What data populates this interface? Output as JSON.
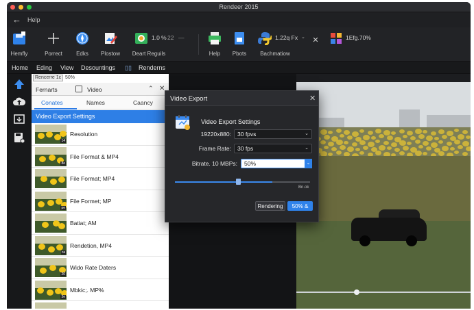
{
  "window": {
    "title": "Rendeer 2015"
  },
  "nav": {
    "back_label": "←",
    "help_label": "Help"
  },
  "ribbon": {
    "tools": [
      {
        "label": "Hemfly"
      },
      {
        "label": "Porrect"
      },
      {
        "label": "Edks"
      },
      {
        "label": "Plostow"
      },
      {
        "label": "Deart Reguils",
        "value": "1.0 %",
        "value2": "22"
      },
      {
        "label": "Help"
      },
      {
        "label": "Pbots"
      },
      {
        "label": "Bachmatiow",
        "value": "1.22q Fx"
      },
      {
        "label": "",
        "value": "1Efg.70%"
      }
    ],
    "close_glyph": "✕"
  },
  "menu": {
    "items": [
      "Home",
      "Eding",
      "View",
      "Desountings",
      "Renderns"
    ],
    "icon_glyph": "▯▯"
  },
  "panel": {
    "render_badge": "Rencerre 1c",
    "render_value": "50%",
    "header": {
      "left": "Fernarts",
      "right": "Video",
      "collapse": "⌃",
      "close": "✕"
    },
    "tabs": [
      "Conates",
      "Names",
      "Caancy"
    ],
    "section_title": "Video Export Settings",
    "items": [
      {
        "label": "Resolution",
        "tag": "14"
      },
      {
        "label": "File Format & MP4",
        "tag": "8e"
      },
      {
        "label": "File Format; MP4",
        "tag": ""
      },
      {
        "label": "File Formet; MP",
        "tag": "pe"
      },
      {
        "label": "Batiat; AM",
        "tag": ""
      },
      {
        "label": "Rendetion, MP4",
        "tag": "ca"
      },
      {
        "label": "Wido Rate Daters",
        "tag": "20"
      },
      {
        "label": "Mbkic;. MP%",
        "tag": "3e"
      },
      {
        "label": "Condatires",
        "tag": ""
      }
    ]
  },
  "dialog": {
    "title": "Video Export",
    "close": "✕",
    "heading": "Video Export Settings",
    "rows": [
      {
        "label": "19220x880:",
        "value": "30 fpvs"
      },
      {
        "label": "Frame Rate:",
        "value": "30 fps"
      }
    ],
    "bitrate": {
      "label": "Bitrate. 10 MBPs:",
      "value": "50%"
    },
    "slider": {
      "fraction": 0.72,
      "caption": "Bn.ok"
    },
    "caret_glyph": "⌄",
    "buttons": {
      "secondary": "Rendering",
      "primary": "50% &"
    }
  },
  "colors": {
    "accent": "#2f82ea",
    "window_bg": "#1c1d20",
    "dialog_bg": "#26272a"
  }
}
